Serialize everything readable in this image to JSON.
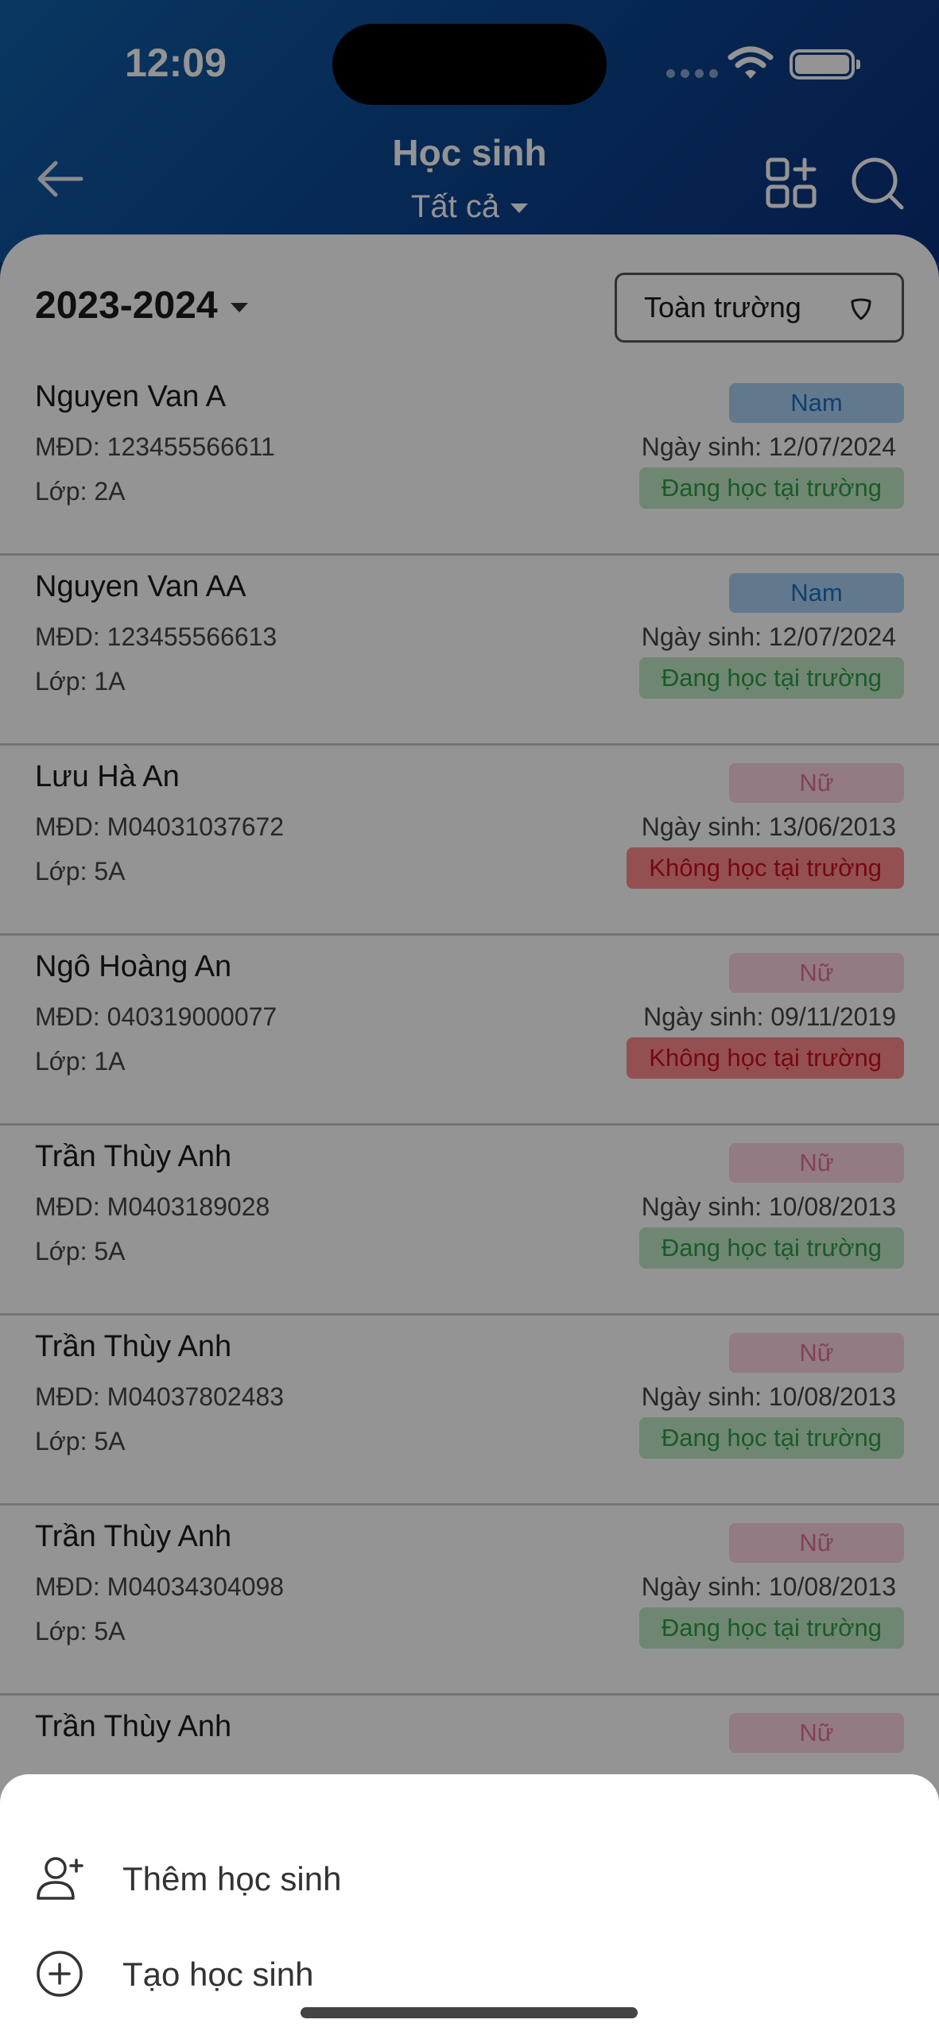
{
  "status_bar": {
    "time": "12:09"
  },
  "header": {
    "title": "Học sinh",
    "filter_label": "Tất cả"
  },
  "toolbar": {
    "school_year": "2023-2024",
    "scope_label": "Toàn trường"
  },
  "students": [
    {
      "name": "Nguyen Van A",
      "code": "MĐD: 123455566611",
      "class": "Lớp: 2A",
      "gender": "Nam",
      "dob": "Ngày sinh: 12/07/2024",
      "status": "Đang học tại trường"
    },
    {
      "name": "Nguyen Van AA",
      "code": "MĐD: 123455566613",
      "class": "Lớp: 1A",
      "gender": "Nam",
      "dob": "Ngày sinh: 12/07/2024",
      "status": "Đang học tại trường"
    },
    {
      "name": "Lưu Hà An",
      "code": "MĐD: M04031037672",
      "class": "Lớp: 5A",
      "gender": "Nữ",
      "dob": "Ngày sinh: 13/06/2013",
      "status": "Không học tại trường"
    },
    {
      "name": "Ngô Hoàng An",
      "code": "MĐD: 040319000077",
      "class": "Lớp: 1A",
      "gender": "Nữ",
      "dob": "Ngày sinh: 09/11/2019",
      "status": "Không học tại trường"
    },
    {
      "name": "Trần Thùy Anh",
      "code": "MĐD: M0403189028",
      "class": "Lớp: 5A",
      "gender": "Nữ",
      "dob": "Ngày sinh: 10/08/2013",
      "status": "Đang học tại trường"
    },
    {
      "name": "Trần Thùy Anh",
      "code": "MĐD: M04037802483",
      "class": "Lớp: 5A",
      "gender": "Nữ",
      "dob": "Ngày sinh: 10/08/2013",
      "status": "Đang học tại trường"
    },
    {
      "name": "Trần Thùy Anh",
      "code": "MĐD: M04034304098",
      "class": "Lớp: 5A",
      "gender": "Nữ",
      "dob": "Ngày sinh: 10/08/2013",
      "status": "Đang học tại trường"
    },
    {
      "name": "Trần Thùy Anh",
      "code": "",
      "class": "",
      "gender": "Nữ",
      "dob": "",
      "status": ""
    }
  ],
  "sheet": {
    "add_student": "Thêm học sinh",
    "create_student": "Tạo học sinh"
  },
  "colors": {
    "header_blue": "#0c4892",
    "male_badge": "#a9d0f3",
    "female_badge": "#fbd4e0",
    "status_active": "#bfe9c5",
    "status_inactive": "#ff8a8a"
  },
  "icons": {
    "back": "arrow-left-icon",
    "grid": "grid-add-icon",
    "search": "search-icon",
    "filter": "shield-filter-icon",
    "add_user": "user-add-icon",
    "create": "plus-circle-icon"
  }
}
